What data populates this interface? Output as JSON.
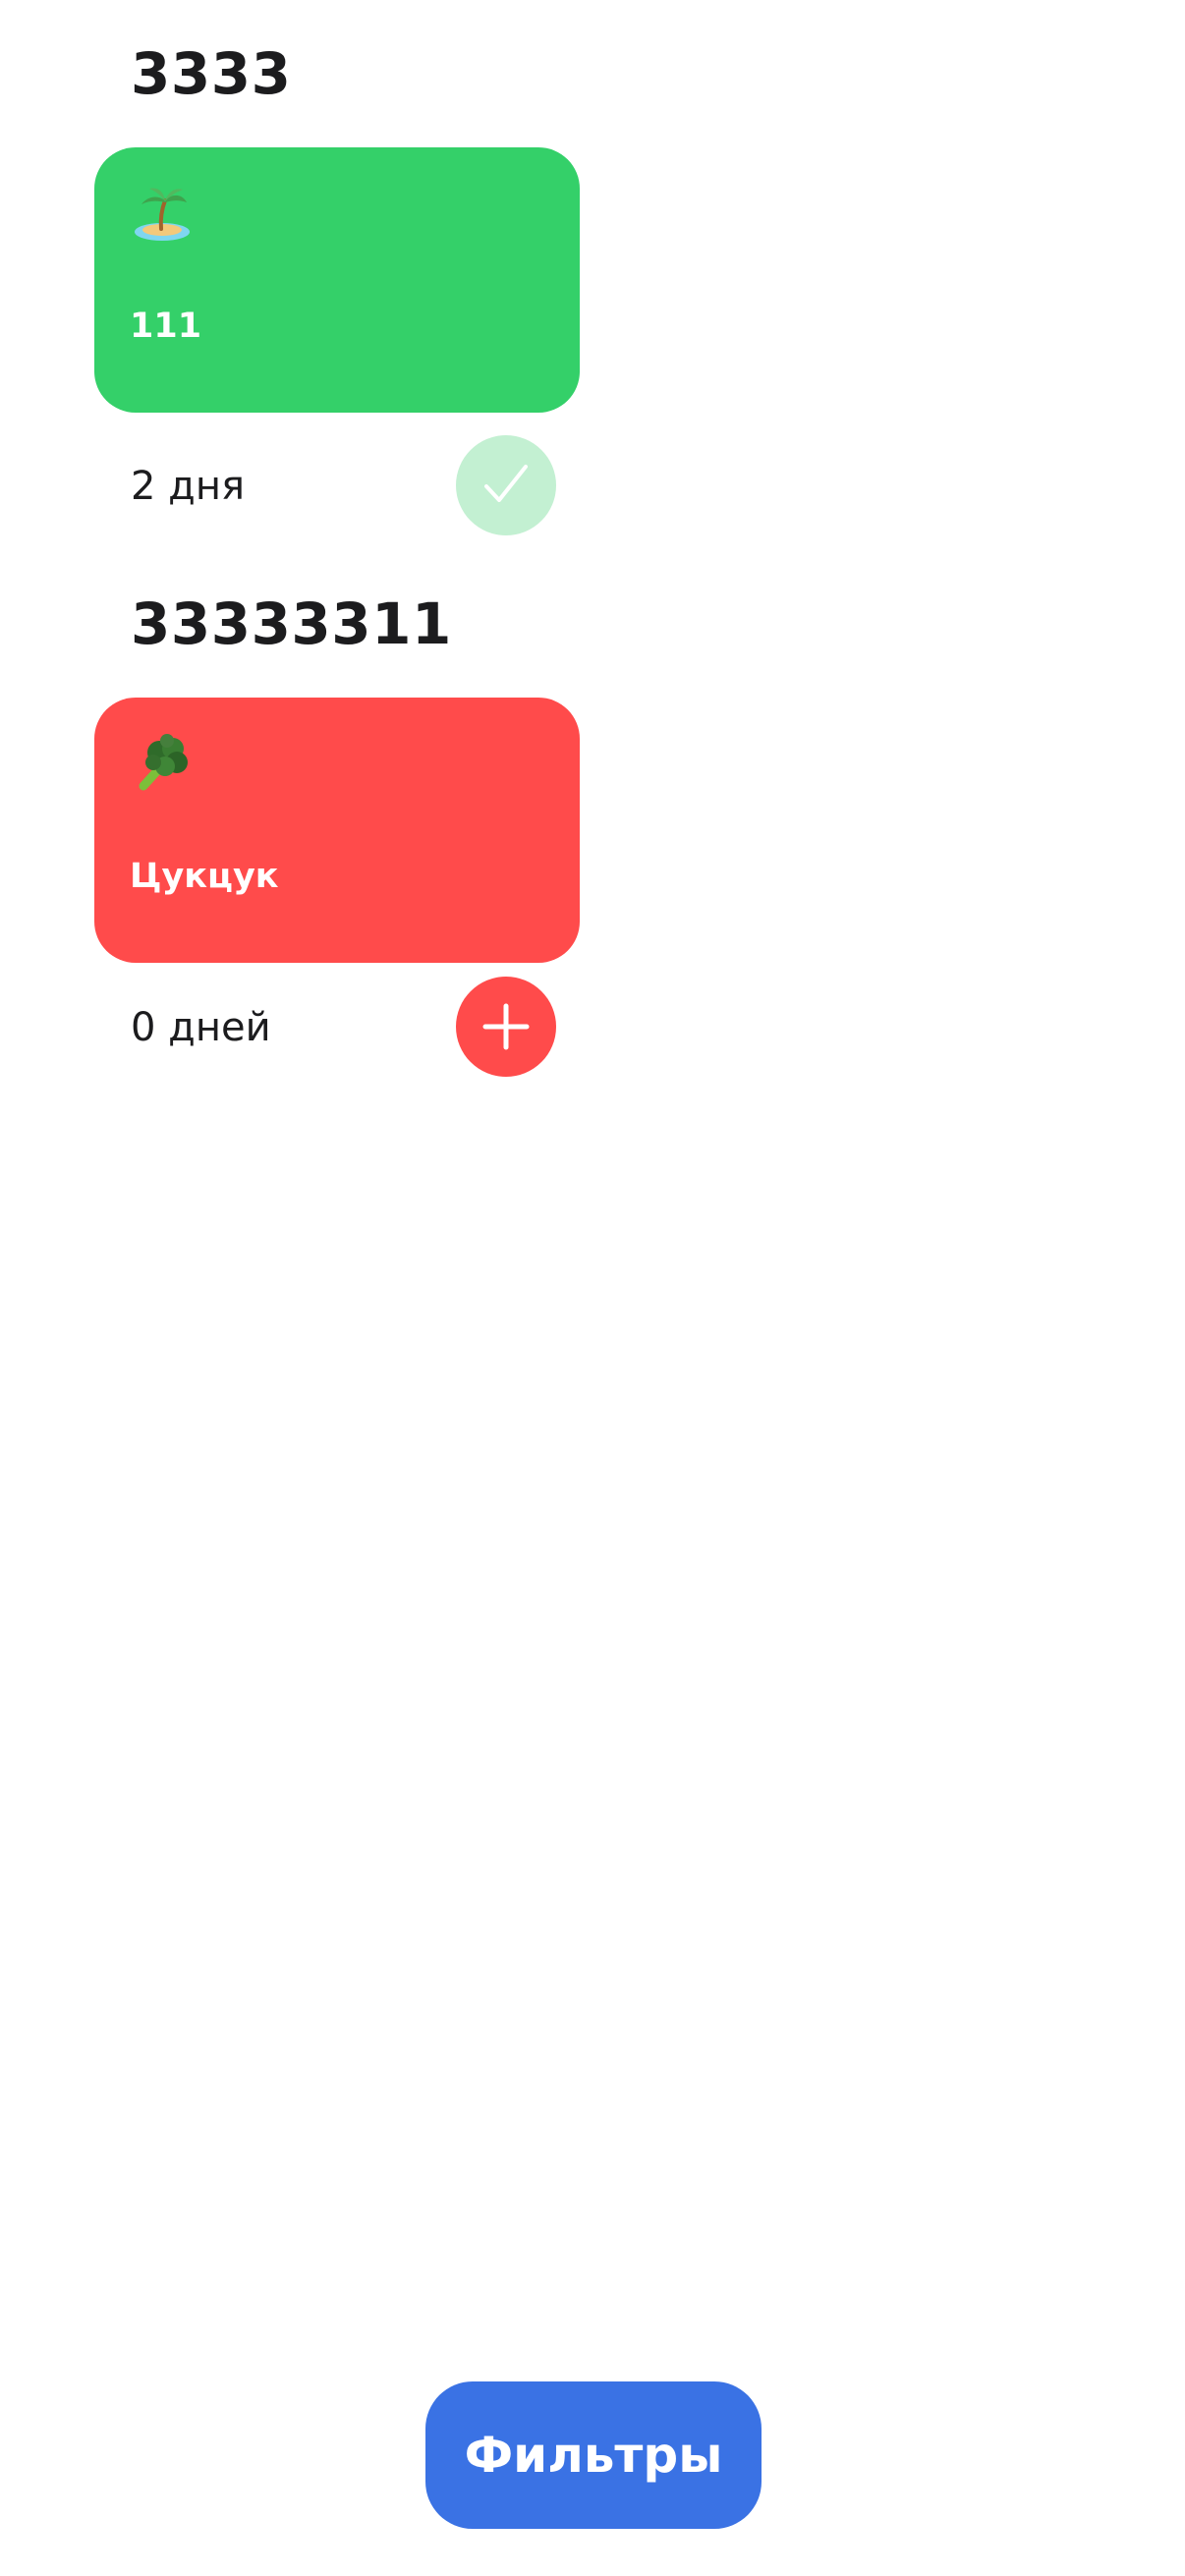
{
  "colors": {
    "background": "#ffffff",
    "text_primary": "#1c1c1e",
    "card_green": "#34d069",
    "card_red": "#ff4b4b",
    "check_button_bg": "#c3f0d2",
    "add_button_bg": "#ff4b4b",
    "filters_button_bg": "#3a72e4"
  },
  "habits": [
    {
      "title": "3333",
      "emoji_icon": "palm-island-icon",
      "card_label": "111",
      "card_color": "#34d069",
      "days": "2 дня",
      "action": "completed-check"
    },
    {
      "title": "33333311",
      "emoji_icon": "broccoli-icon",
      "card_label": "Цукцук",
      "card_color": "#ff4b4b",
      "days": "0 дней",
      "action": "add-plus"
    }
  ],
  "filters_button": {
    "label": "Фильтры"
  }
}
